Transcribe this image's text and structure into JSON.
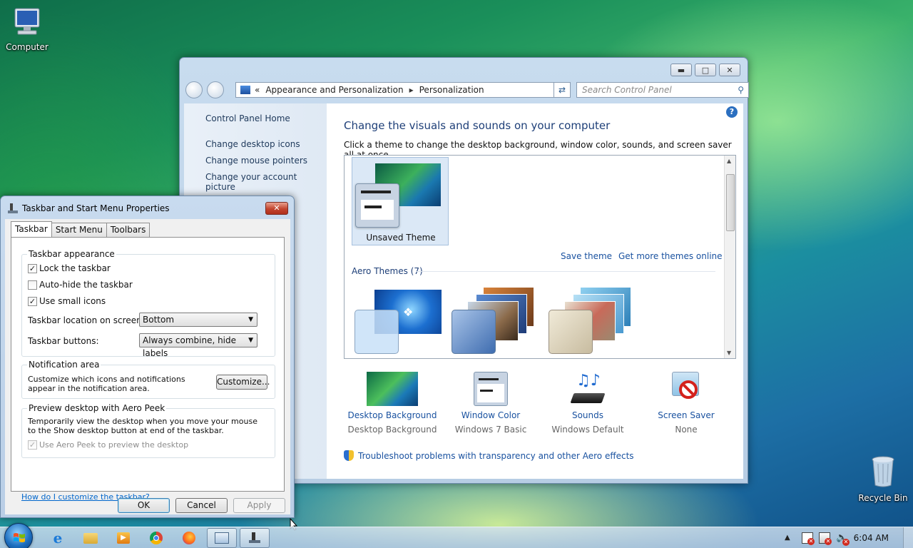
{
  "desktop": {
    "computer_label": "Computer",
    "recycle_label": "Recycle Bin"
  },
  "control_panel": {
    "address": {
      "segment1": "Appearance and Personalization",
      "segment2": "Personalization"
    },
    "search_placeholder": "Search Control Panel",
    "left_links": {
      "home": "Control Panel Home",
      "desktop_icons": "Change desktop icons",
      "mouse_pointers": "Change mouse pointers",
      "account_picture": "Change your account picture"
    },
    "title": "Change the visuals and sounds on your computer",
    "subtitle": "Click a theme to change the desktop background, window color, sounds, and screen saver all at once.",
    "unsaved_theme": "Unsaved Theme",
    "save_theme": "Save theme",
    "get_more": "Get more themes online",
    "aero_group": "Aero Themes (7)",
    "quick": {
      "bg_label": "Desktop Background",
      "bg_value": "Desktop Background",
      "color_label": "Window Color",
      "color_value": "Windows 7 Basic",
      "sounds_label": "Sounds",
      "sounds_value": "Windows Default",
      "saver_label": "Screen Saver",
      "saver_value": "None"
    },
    "troubleshoot": "Troubleshoot problems with transparency and other Aero effects"
  },
  "dialog": {
    "title": "Taskbar and Start Menu Properties",
    "tabs": [
      "Taskbar",
      "Start Menu",
      "Toolbars"
    ],
    "appearance": {
      "legend": "Taskbar appearance",
      "lock": "Lock the taskbar",
      "autohide": "Auto-hide the taskbar",
      "small_icons": "Use small icons",
      "location_label": "Taskbar location on screen:",
      "location_value": "Bottom",
      "buttons_label": "Taskbar buttons:",
      "buttons_value": "Always combine, hide labels"
    },
    "notification": {
      "legend": "Notification area",
      "text": "Customize which icons and notifications appear in the notification area.",
      "customize": "Customize..."
    },
    "peek": {
      "legend": "Preview desktop with Aero Peek",
      "text": "Temporarily view the desktop when you move your mouse to the Show desktop button at end of the taskbar.",
      "use": "Use Aero Peek to preview the desktop"
    },
    "help_link": "How do I customize the taskbar?",
    "ok": "OK",
    "cancel": "Cancel",
    "apply": "Apply"
  },
  "taskbar": {
    "clock": "6:04 AM"
  }
}
